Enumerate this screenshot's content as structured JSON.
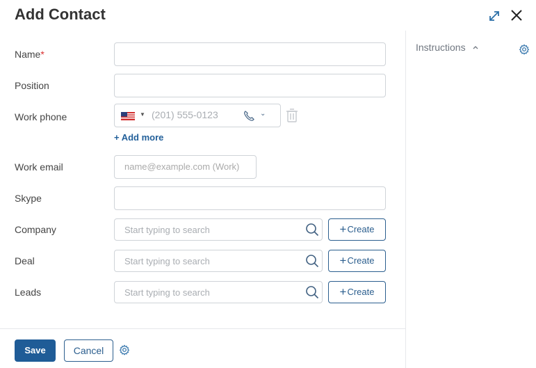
{
  "title": "Add Contact",
  "fields": {
    "name": {
      "label": "Name",
      "required_mark": "*"
    },
    "position": {
      "label": "Position"
    },
    "work_phone": {
      "label": "Work phone",
      "placeholder": "(201) 555-0123",
      "country": "US"
    },
    "add_more": "+ Add more",
    "work_email": {
      "label": "Work email",
      "placeholder": "name@example.com (Work)"
    },
    "skype": {
      "label": "Skype"
    },
    "company": {
      "label": "Company",
      "placeholder": "Start typing to search",
      "create": "Create"
    },
    "deal": {
      "label": "Deal",
      "placeholder": "Start typing to search",
      "create": "Create"
    },
    "leads": {
      "label": "Leads",
      "placeholder": "Start typing to search",
      "create": "Create"
    }
  },
  "footer": {
    "save": "Save",
    "cancel": "Cancel"
  },
  "instructions": {
    "label": "Instructions"
  },
  "icons": [
    "expand-icon",
    "close-icon",
    "phone-icon",
    "trash-icon",
    "search-icon",
    "gear-icon",
    "chevron-up-icon"
  ],
  "colors": {
    "primary": "#1f5c97",
    "link": "#23609a",
    "border": "#cfd3d8",
    "required": "#d93030"
  }
}
